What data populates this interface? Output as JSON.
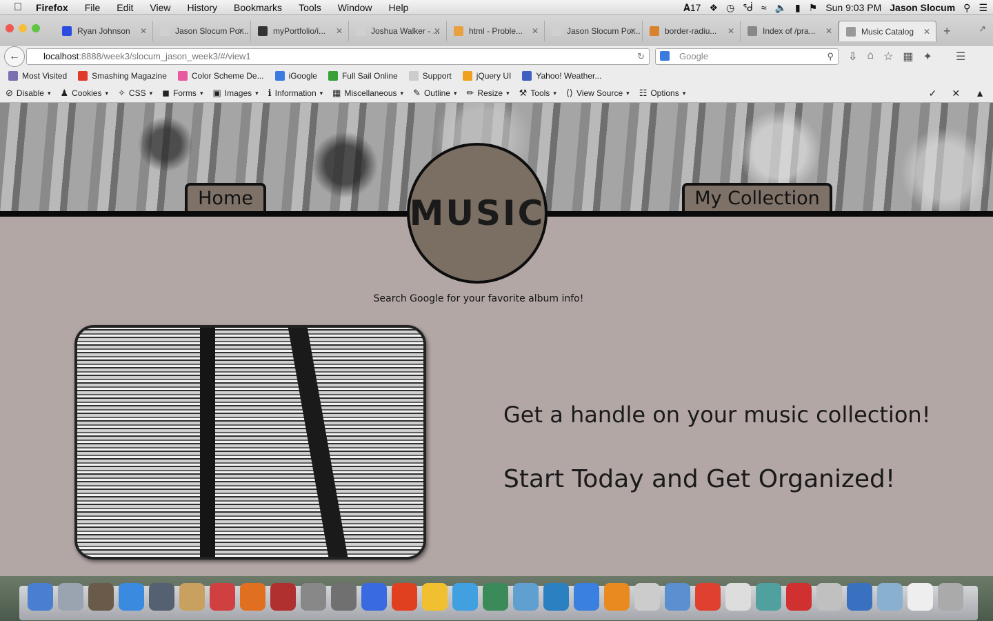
{
  "menubar": {
    "app": "Firefox",
    "items": [
      "File",
      "Edit",
      "View",
      "History",
      "Bookmarks",
      "Tools",
      "Window",
      "Help"
    ],
    "badge_count": "17",
    "clock": "Sun 9:03 PM",
    "user": "Jason Slocum"
  },
  "tabs": [
    {
      "label": "Ryan Johnson",
      "color": "#2a4de0"
    },
    {
      "label": "Jason Slocum Por...",
      "color": "#d0d0d0"
    },
    {
      "label": "myPortfolio/i...",
      "color": "#333333"
    },
    {
      "label": "Joshua Walker - ...",
      "color": "#d0d0d0"
    },
    {
      "label": "html - Proble...",
      "color": "#e8a040"
    },
    {
      "label": "Jason Slocum Por...",
      "color": "#d0d0d0"
    },
    {
      "label": "border-radiu...",
      "color": "#d9822b"
    },
    {
      "label": "Index of /pra...",
      "color": "#888888"
    },
    {
      "label": "Music Catalog",
      "color": "#999999",
      "active": true
    }
  ],
  "navbar": {
    "url_host": "localhost",
    "url_rest": ":8888/week3/slocum_jason_week3/#/view1",
    "search_placeholder": "Google"
  },
  "bookmarks": [
    {
      "label": "Most Visited",
      "color": "#7a6fb0"
    },
    {
      "label": "Smashing Magazine",
      "color": "#e03a2a"
    },
    {
      "label": "Color Scheme De...",
      "color": "#e85aa0"
    },
    {
      "label": "iGoogle",
      "color": "#3b7be0"
    },
    {
      "label": "Full Sail Online",
      "color": "#3aa03a"
    },
    {
      "label": "Support",
      "color": "#cccccc"
    },
    {
      "label": "jQuery UI",
      "color": "#f0a020"
    },
    {
      "label": "Yahoo! Weather...",
      "color": "#4060c0"
    }
  ],
  "devbar": [
    "Disable",
    "Cookies",
    "CSS",
    "Forms",
    "Images",
    "Information",
    "Miscellaneous",
    "Outline",
    "Resize",
    "Tools",
    "View Source",
    "Options"
  ],
  "site": {
    "logo": "MUSIC",
    "nav_home": "Home",
    "nav_collection": "My Collection",
    "tagline": "Search Google for your favorite album info!",
    "headline_1": "Get a handle on your music collection!",
    "headline_2": "Start Today and Get Organized!"
  },
  "dock_colors": [
    "#4a7fd0",
    "#9aa4b0",
    "#6a5a4a",
    "#3a8ae0",
    "#556070",
    "#c8a060",
    "#d04040",
    "#e07020",
    "#b03030",
    "#888888",
    "#707070",
    "#3a6ae0",
    "#e04020",
    "#f0c030",
    "#40a0e0",
    "#3a8a5a",
    "#60a0d0",
    "#2a80c0",
    "#3a80e0",
    "#e88a20",
    "#cccccc",
    "#5a90d0",
    "#e04030",
    "#dddddd",
    "#50a0a0",
    "#d03030",
    "#c0c0c0",
    "#3a70c0",
    "#8ab0d0",
    "#eeeeee",
    "#aaaaaa"
  ]
}
